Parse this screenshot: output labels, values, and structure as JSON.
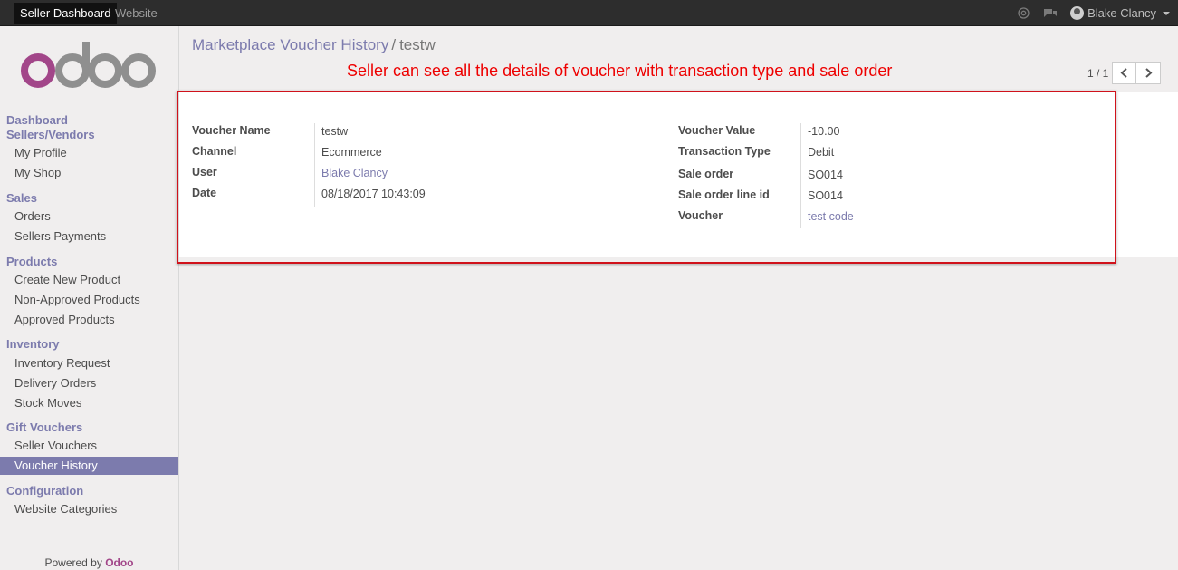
{
  "topbar": {
    "apps": [
      "Seller Dashboard",
      "Website"
    ],
    "user": "Blake Clancy"
  },
  "sidebar": {
    "logo": "odoo",
    "sections": [
      {
        "title": "Dashboard"
      },
      {
        "title": "Sellers/Vendors",
        "items": [
          "My Profile",
          "My Shop"
        ]
      },
      {
        "title": "Sales",
        "items": [
          "Orders",
          "Sellers Payments"
        ]
      },
      {
        "title": "Products",
        "items": [
          "Create New Product",
          "Non-Approved Products",
          "Approved Products"
        ]
      },
      {
        "title": "Inventory",
        "items": [
          "Inventory Request",
          "Delivery Orders",
          "Stock Moves"
        ]
      },
      {
        "title": "Gift Vouchers",
        "items": [
          "Seller Vouchers",
          "Voucher History"
        ]
      },
      {
        "title": "Configuration",
        "items": [
          "Website Categories"
        ]
      }
    ],
    "active_item": "Voucher History",
    "powered_by": "Powered by",
    "powered_brand": "Odoo"
  },
  "breadcrumb": {
    "parent": "Marketplace Voucher History",
    "separator": "/",
    "current": "testw"
  },
  "annotation": "Seller can see all the details of voucher with transaction type and sale order",
  "pager": {
    "value": "1 / 1"
  },
  "form": {
    "left": [
      {
        "label": "Voucher Name",
        "value": "testw"
      },
      {
        "label": "Channel",
        "value": "Ecommerce"
      },
      {
        "label": "User",
        "value": "Blake Clancy"
      },
      {
        "label": "Date",
        "value": "08/18/2017 10:43:09"
      }
    ],
    "right": [
      {
        "label": "Voucher Value",
        "value": "-10.00"
      },
      {
        "label": "Transaction Type",
        "value": "Debit"
      },
      {
        "label": "Sale order",
        "value": "SO014"
      },
      {
        "label": "Sale order line id",
        "value": "SO014"
      },
      {
        "label": "Voucher",
        "value": "test code"
      }
    ]
  },
  "colors": {
    "accent": "#7c7bad",
    "annotation": "#e00000",
    "logo": "#a24689"
  }
}
